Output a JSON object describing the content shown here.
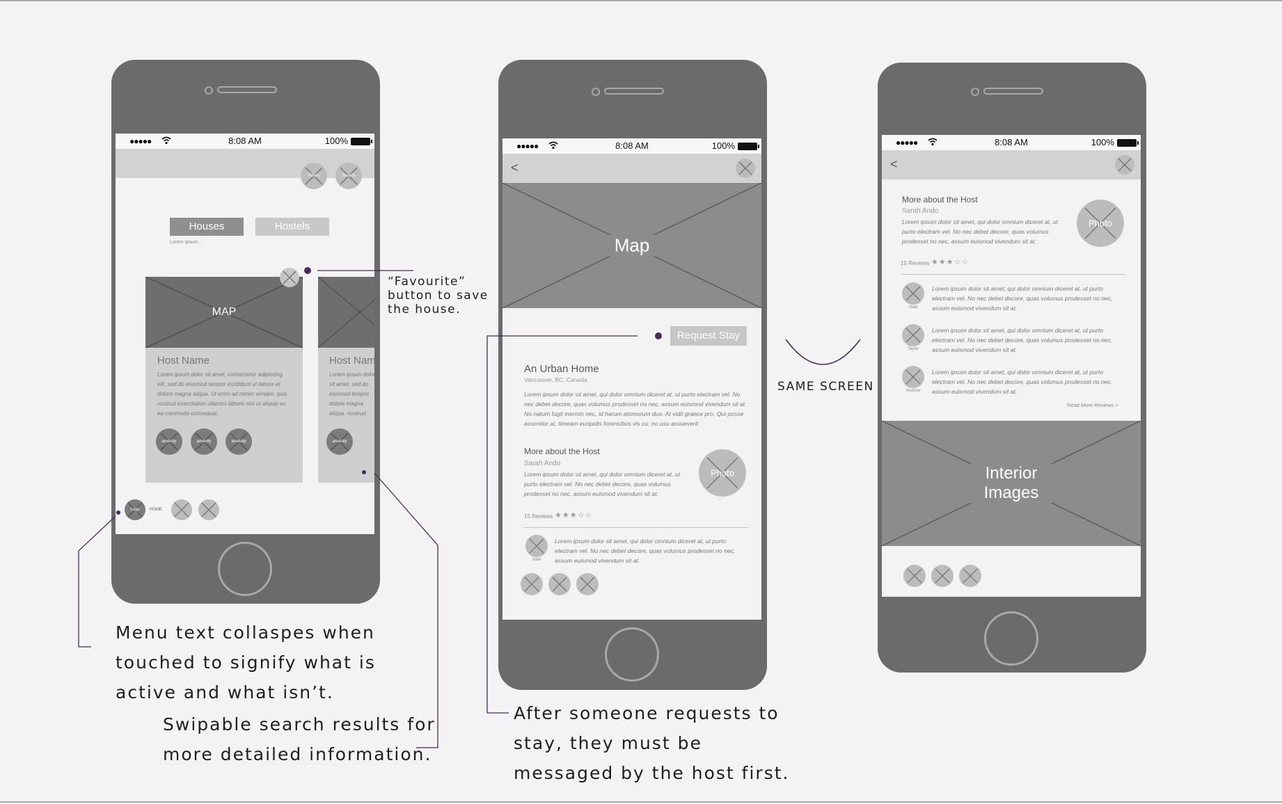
{
  "status_bar": {
    "signal": "●●●●●",
    "time": "8:08 AM",
    "battery": "100%"
  },
  "phone1": {
    "filters_label": "Filters",
    "search_label": "Search",
    "tabs": [
      "Houses",
      "Hostels"
    ],
    "tab_caption": "Lorem ipsum...",
    "card": {
      "map_label": "MAP",
      "host_name": "Host Name",
      "description": "Lorem ipsum dolor sit amet, consectetur adipiscing elit, sed do eiusmod tempor incididunt ut labore et dolore magna aliqua. Ut enim ad minim veniam, quis nostrud exercitation ullamco laboris nisi ut aliquip ex ea commodo consequat.",
      "amenities": [
        "amenity",
        "amenity",
        "amenity"
      ]
    },
    "card2": {
      "host_name": "Host Name",
      "description": "Lorem ipsum dolor sit amet, sed do eiusmod tempor dolore magna aliqua. nostrud exercitation ex ea commodo con",
      "amenity": "amenity"
    },
    "bottom_nav": {
      "logo": "Logo",
      "home_label": "HOME"
    }
  },
  "phone2": {
    "map_label": "Map",
    "request_button": "Request Stay",
    "listing_title": "An Urban Home",
    "listing_location": "Vancouver, BC, Canada",
    "listing_description": "Lorem ipsum dolor sit amet, qui dolor omnium diceret at, ut purto electram vel. No nec debet decore, quas volumus prodesset no nec, assum euismod vivendum sit at. No natum fugit inermis nec, id harum atomorum duo. At vidit graece pro. Qui posse assentior at, timeam euripidis forensibus vis cu, no usu assueverit",
    "host_section": {
      "title": "More about the Host",
      "name": "Sarah Ando",
      "bio": "Lorem ipsum dolor sit amet, qui dolor omnium diceret at, ut purto electram vel. No nec debet decore, quas volumus prodesset no nec, assum euismod vivendum sit at.",
      "photo_label": "Photo"
    },
    "reviews_count": "15 Reviews",
    "stars": "★★★☆☆",
    "review": {
      "reviewer": "Nate",
      "text": "Lorem ipsum dolor sit amet, qui dolor omnium diceret at, ut purto electram vel. No nec debet decore, quas volumus prodesset no nec, assum euismod vivendum sit at."
    }
  },
  "phone3": {
    "host_section": {
      "title": "More about the Host",
      "name": "Sarah Ando",
      "bio": "Lorem ipsum dolor sit amet, qui dolor omnium diceret at, ut purto electram vel. No nec debet decore, quas volumus prodesset no nec, assum euismod vivendum sit at.",
      "photo_label": "Photo"
    },
    "reviews_count": "15 Reviews",
    "stars": "★★★☆☆",
    "reviews": [
      {
        "reviewer": "Nate",
        "text": "Lorem ipsum dolor sit amet, qui dolor omnium diceret at, ut purto electram vel. No nec debet decore, quas volumus prodesset no nec, assum euismod vivendum sit at."
      },
      {
        "reviewer": "Taylor",
        "text": "Lorem ipsum dolor sit amet, qui dolor omnium diceret at, ut purto electram vel. No nec debet decore, quas volumus prodesset no nec, assum euismod vivendum sit at."
      },
      {
        "reviewer": "Andrew",
        "text": "Lorem ipsum dolor sit amet, qui dolor omnium diceret at, ut purto electram vel. No nec debet decore, quas volumus prodesset no nec, assum euismod vivendum sit at."
      }
    ],
    "read_more": "Read More Reviews >",
    "interior_label": "Interior Images"
  },
  "annotations": {
    "favourite": [
      "“Favourite”",
      "button to save",
      "the house."
    ],
    "menu": [
      "Menu text collaspes when",
      "touched to signify what is",
      "active and what isn’t."
    ],
    "swipe": [
      "Swipable search results for",
      "more detailed information."
    ],
    "request": [
      "After someone requests to",
      "stay, they must be",
      "messaged by the host first."
    ],
    "same_screen": "SAME SCREEN"
  },
  "colors": {
    "accent": "#4b2a5e",
    "phone_body": "#6b6b6b",
    "placeholder": "#8c8c8c",
    "background": "#f2f3f2"
  }
}
